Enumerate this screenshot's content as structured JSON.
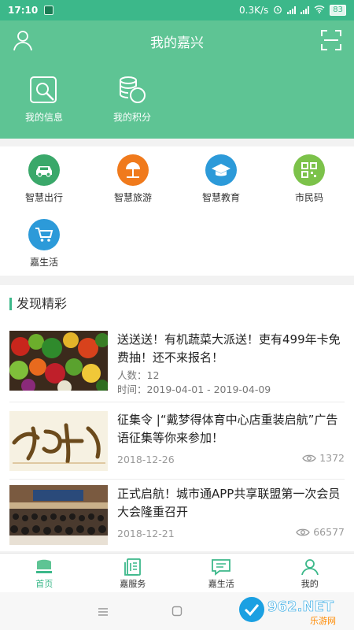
{
  "status_bar": {
    "time": "17:10",
    "speed": "0.3K/s",
    "battery": "83"
  },
  "header": {
    "title": "我的嘉兴",
    "items": [
      {
        "label": "我的信息",
        "icon": "search-card-icon"
      },
      {
        "label": "我的积分",
        "icon": "coins-icon"
      }
    ]
  },
  "services": [
    {
      "label": "智慧出行",
      "icon": "car-icon",
      "color": "#3aa86a"
    },
    {
      "label": "智慧旅游",
      "icon": "beach-umbrella-icon",
      "color": "#f07a1c"
    },
    {
      "label": "智慧教育",
      "icon": "graduation-cap-icon",
      "color": "#2c9ad9"
    },
    {
      "label": "市民码",
      "icon": "qr-code-icon",
      "color": "#7cc24a"
    },
    {
      "label": "嘉生活",
      "icon": "shopping-cart-icon",
      "color": "#2c9ad9"
    }
  ],
  "discover": {
    "title": "发现精彩",
    "news": [
      {
        "title": "送送送！有机蔬菜大派送！吏有499年卡免费抽！还不来报名！",
        "line1": "人数：12",
        "line2": "时间：2019-04-01 - 2019-04-09"
      },
      {
        "title": "征集令 |“戴梦得体育中心店重装启航”广告语征集等你来参加！",
        "date": "2018-12-26",
        "views": "1372"
      },
      {
        "title": "正式启航！城市通APP共享联盟第一次会员大会隆重召开",
        "date": "2018-12-21",
        "views": "66577"
      }
    ]
  },
  "bottom_nav": [
    {
      "label": "首页",
      "active": true
    },
    {
      "label": "嘉服务"
    },
    {
      "label": "嘉生活"
    },
    {
      "label": "我的"
    }
  ],
  "watermark": {
    "main": "962.NET",
    "sub": "乐游网"
  },
  "colors": {
    "brand": "#5ec494",
    "accent": "#3cb88a"
  }
}
